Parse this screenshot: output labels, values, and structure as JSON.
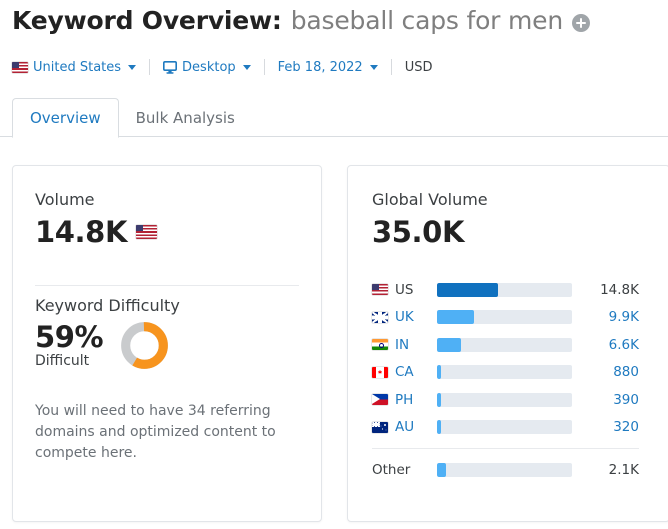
{
  "header": {
    "title_prefix": "Keyword Overview:",
    "keyword": "baseball caps for men",
    "add_keyword_icon": "plus-circle-icon"
  },
  "filters": {
    "country": "United States",
    "country_flag": "us-flag-icon",
    "device": "Desktop",
    "device_icon": "monitor-icon",
    "date": "Feb 18, 2022",
    "currency": "USD"
  },
  "tabs": [
    {
      "label": "Overview",
      "active": true
    },
    {
      "label": "Bulk Analysis",
      "active": false
    }
  ],
  "volume_card": {
    "volume_label": "Volume",
    "volume_value": "14.8K",
    "volume_flag": "us-flag-icon",
    "kd_label": "Keyword Difficulty",
    "kd_value": "59%",
    "kd_word": "Difficult",
    "kd_percent": 59,
    "kd_note": "You will need to have 34 referring domains and optimized content to compete here.",
    "donut_fill_color": "#f7941e",
    "donut_track_color": "#c9cbcd"
  },
  "global_volume_card": {
    "title": "Global Volume",
    "total": "35.0K",
    "other_label": "Other"
  },
  "chart_data": {
    "type": "bar",
    "title": "Global Volume",
    "total": 35000,
    "total_label": "35.0K",
    "orientation": "horizontal",
    "categories": [
      "US",
      "UK",
      "IN",
      "CA",
      "PH",
      "AU",
      "Other"
    ],
    "values": [
      14800,
      9900,
      6600,
      880,
      390,
      320,
      2100
    ],
    "value_labels": [
      "14.8K",
      "9.9K",
      "6.6K",
      "880",
      "390",
      "320",
      "2.1K"
    ],
    "bar_percent": [
      45,
      27.5,
      17.5,
      3,
      3,
      3,
      7
    ],
    "rows": [
      {
        "code": "US",
        "flag": "us-flag-icon",
        "value_label": "14.8K",
        "percent": 45,
        "highlight": true
      },
      {
        "code": "UK",
        "flag": "uk-flag-icon",
        "value_label": "9.9K",
        "percent": 27.5,
        "highlight": false
      },
      {
        "code": "IN",
        "flag": "in-flag-icon",
        "value_label": "6.6K",
        "percent": 17.5,
        "highlight": false
      },
      {
        "code": "CA",
        "flag": "ca-flag-icon",
        "value_label": "880",
        "percent": 3,
        "highlight": false
      },
      {
        "code": "PH",
        "flag": "ph-flag-icon",
        "value_label": "390",
        "percent": 3,
        "highlight": false
      },
      {
        "code": "AU",
        "flag": "au-flag-icon",
        "value_label": "320",
        "percent": 3,
        "highlight": false
      }
    ],
    "other_row": {
      "code": "Other",
      "value_label": "2.1K",
      "percent": 7
    },
    "colors": {
      "bar_highlight": "#1071bf",
      "bar_default": "#4fb0f5",
      "track": "#e5eaf0"
    },
    "legend": "none",
    "grid": false
  },
  "colors": {
    "link": "#1f7ac0",
    "text": "#222222",
    "muted": "#6b7177",
    "accent_orange": "#f7941e"
  }
}
